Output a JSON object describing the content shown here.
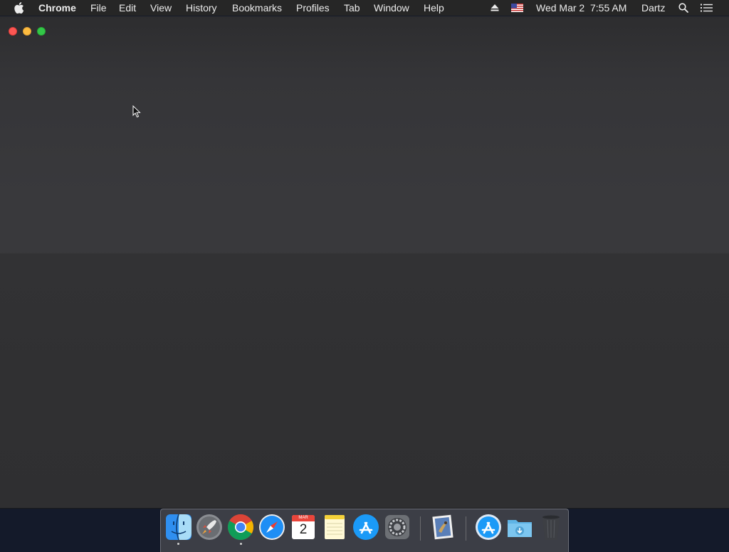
{
  "menubar": {
    "app_name": "Chrome",
    "menus": [
      "File",
      "Edit",
      "View",
      "History",
      "Bookmarks",
      "Profiles",
      "Tab",
      "Window",
      "Help"
    ],
    "datetime": "Wed Mar 2  7:55 AM",
    "user": "Dartz",
    "status_icons": [
      "eject-icon",
      "us-flag-input-icon",
      "spotlight-search-icon",
      "notification-center-icon"
    ]
  },
  "window": {
    "app": "Chrome",
    "state": "blank"
  },
  "dock": {
    "items": [
      "finder",
      "launchpad",
      "chrome",
      "safari",
      "calendar",
      "notes",
      "app-store",
      "system-preferences",
      "preview",
      "applications-folder",
      "downloads-folder",
      "trash"
    ],
    "calendar": {
      "month": "MAR",
      "day": "2"
    },
    "running": [
      "finder",
      "chrome"
    ]
  },
  "colors": {
    "menubar_bg": "#262626",
    "window_bg": "#39393c",
    "desktop_bg": "#141a2a",
    "close": "#fc5753",
    "minimize": "#fdbc40",
    "zoom": "#33c748"
  }
}
